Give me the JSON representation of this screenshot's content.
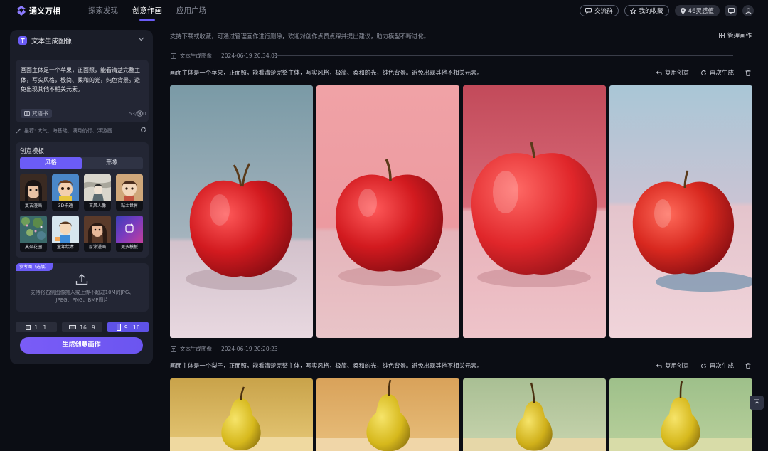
{
  "app": {
    "name": "通义万相"
  },
  "nav": {
    "items": [
      "探索发现",
      "创意作画",
      "应用广场"
    ],
    "active": "创意作画"
  },
  "header": {
    "community": "交流群",
    "favorites": "我的收藏",
    "points": "46灵感值"
  },
  "panel": {
    "title": "文本生成图像",
    "prompt": "画面主体是一个苹果，正面照，能看清楚完整主体，写实风格，极简、柔和的光，纯色背景。避免出现其他不相关元素。",
    "phrase_book": "咒语书",
    "counter": "53/500",
    "hint": "推荐: 大气、海基础、满月航行、浮游画",
    "template_title": "创意模板",
    "tabs": [
      "风格",
      "形象"
    ],
    "active_tab": "风格",
    "templates": [
      "复古漫画",
      "3D卡通",
      "古风人像",
      "黏土世界",
      "莫奈花园",
      "童年绘本",
      "厚涂漫画",
      "更多模板"
    ],
    "reference_badge": "参考图（选填）",
    "upload_text": "支持将右侧图像拖入或上传不超过10M的JPG、JPEG、PNG、BMP图片",
    "ratios": [
      "1 : 1",
      "16 : 9",
      "9 : 16"
    ],
    "active_ratio": "9 : 16",
    "generate": "生成创意画作"
  },
  "main": {
    "notice": "支持下载或收藏，可通过管理画作进行删除，欢迎对创作点赞点踩并提出建议，助力模型不断进化。",
    "manage": "管理画作",
    "groups": [
      {
        "type_label": "文本生成图像",
        "time": "2024-06-19 20:34:01",
        "prompt": "画面主体是一个苹果，正面照，能看清楚完整主体，写实风格，极简、柔和的光，纯色背景。避免出现其他不相关元素。",
        "reuse": "复用创意",
        "regenerate": "再次生成"
      },
      {
        "type_label": "文本生成图像",
        "time": "2024-06-19 20:20:23",
        "prompt": "画面主体是一个梨子，正面照，能看清楚完整主体，写实风格，极简、柔和的光，纯色背景。避免出现其他不相关元素。",
        "reuse": "复用创意",
        "regenerate": "再次生成"
      }
    ]
  },
  "colors": {
    "accent": "#6b5cf6",
    "background": "#0b0d14",
    "panel": "#1a1d28"
  }
}
